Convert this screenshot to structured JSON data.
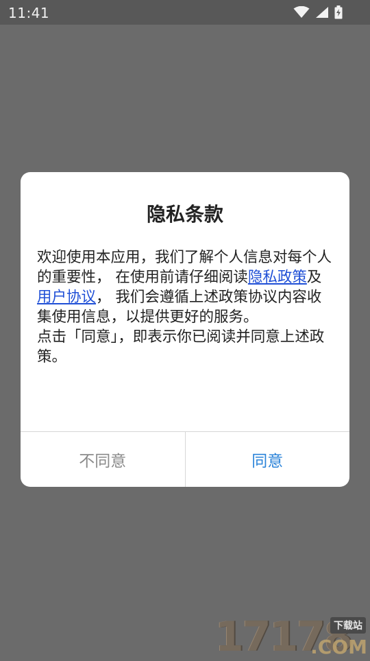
{
  "status_bar": {
    "time": "11:41",
    "icons": [
      "wifi-icon",
      "cellular-icon",
      "battery-charging-icon"
    ]
  },
  "dialog": {
    "title": "隐私条款",
    "body": {
      "part1": "欢迎使用本应用，我们了解个人信息对每个人的重要性， 在使用前请仔细阅读",
      "link_privacy": "隐私政策",
      "and": "及",
      "link_terms": "用户协议",
      "part2": "， 我们会遵循上述政策协议内容收集使用信息，以提供更好的服务。",
      "para2": "点击「同意」，即表示你已阅读并同意上述政策。"
    },
    "buttons": {
      "disagree": "不同意",
      "agree": "同意"
    }
  },
  "watermark": {
    "main": "17178",
    "sub": "下载站",
    "domain": ".COM"
  },
  "colors": {
    "overlay": "#6b6b6b",
    "link": "#1f4fd6",
    "agree": "#2a83d9",
    "disagree": "#8a8a8a"
  }
}
